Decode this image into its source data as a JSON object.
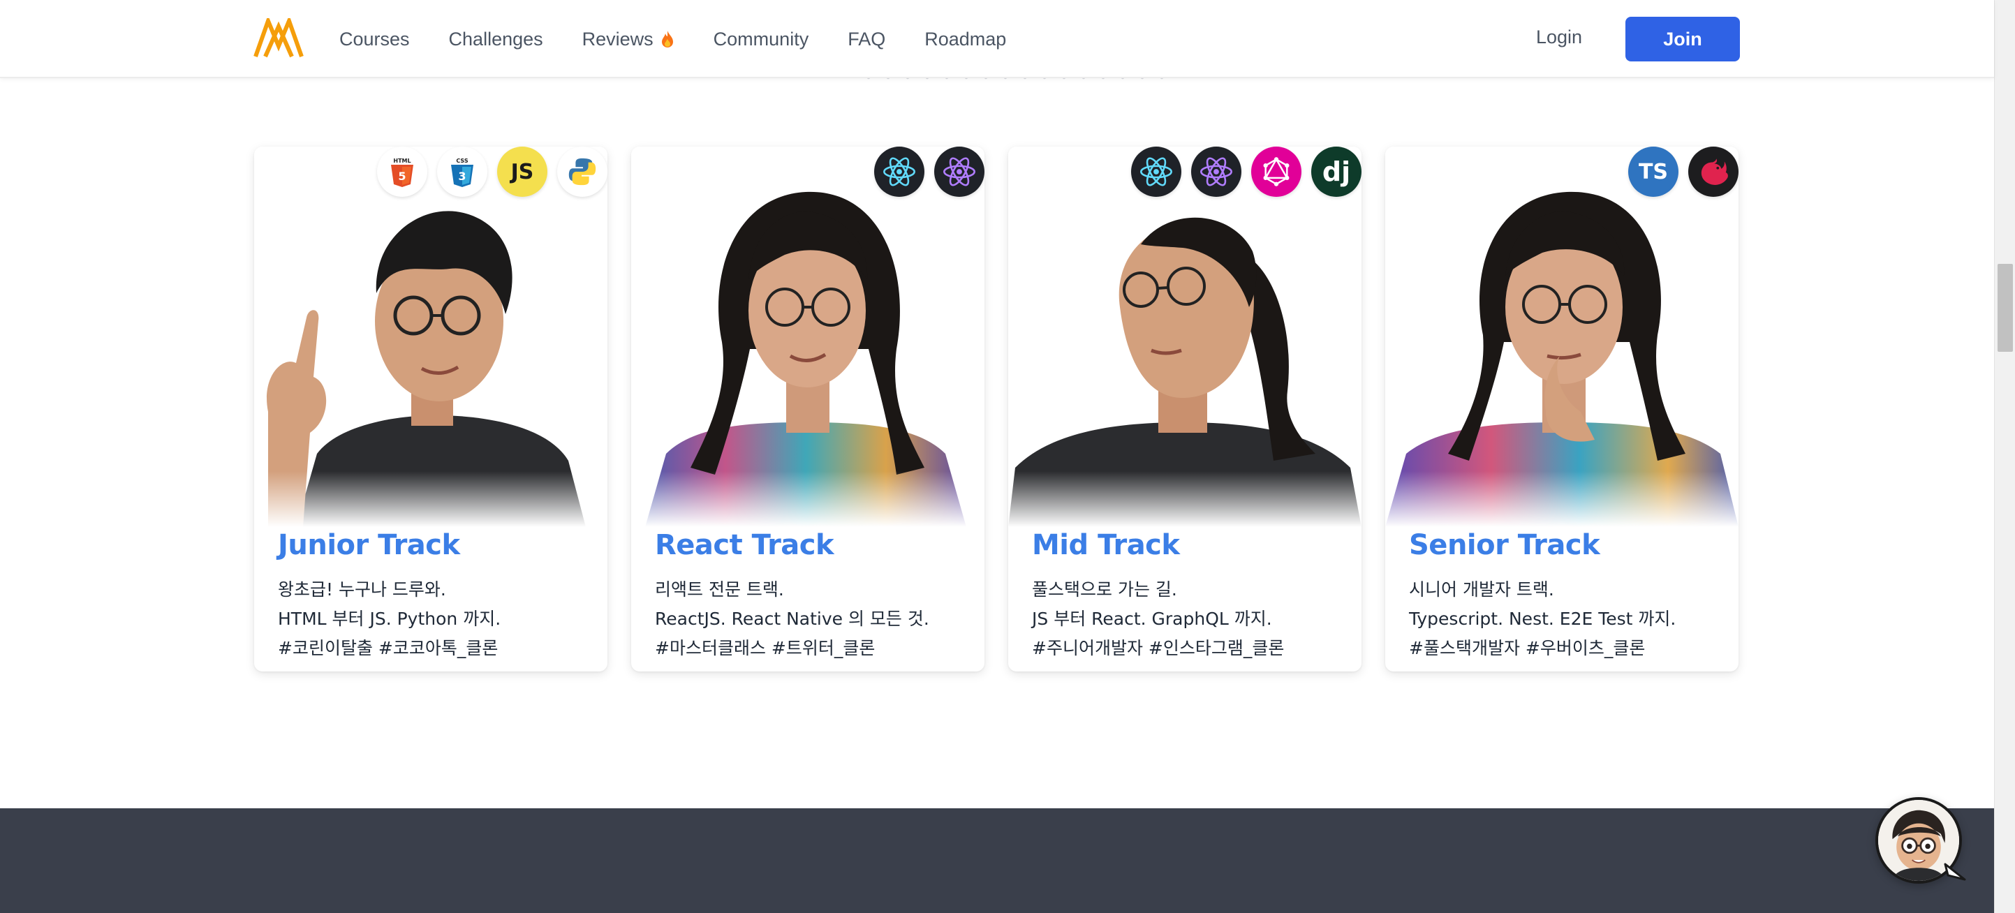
{
  "header": {
    "logo_name": "logo-icon",
    "nav": [
      {
        "label": "Courses"
      },
      {
        "label": "Challenges"
      },
      {
        "label": "Reviews",
        "badge_icon": "flame-icon"
      },
      {
        "label": "Community"
      },
      {
        "label": "FAQ"
      },
      {
        "label": "Roadmap"
      }
    ],
    "login_label": "Login",
    "join_label": "Join"
  },
  "cards": [
    {
      "title": "Junior Track",
      "lines": [
        "왕초급! 누구나 드루와.",
        "HTML 부터 JS. Python 까지.",
        "#코린이탈출 #코코아톡_클론"
      ],
      "tech_icons": [
        "html5-icon",
        "css3-icon",
        "javascript-icon",
        "python-icon"
      ],
      "js_text": "JS"
    },
    {
      "title": "React Track",
      "lines": [
        "리액트 전문 트랙.",
        "ReactJS. React Native 의 모든 것.",
        "#마스터클래스 #트위터_클론"
      ],
      "tech_icons": [
        "react-icon",
        "react-native-icon"
      ]
    },
    {
      "title": "Mid Track",
      "lines": [
        "풀스택으로 가는 길.",
        "JS 부터 React. GraphQL 까지.",
        "#주니어개발자 #인스타그램_클론"
      ],
      "tech_icons": [
        "react-icon",
        "react-native-icon",
        "graphql-icon",
        "django-icon"
      ],
      "dj_text": "dj"
    },
    {
      "title": "Senior Track",
      "lines": [
        "시니어 개발자 트랙.",
        "Typescript. Nest. E2E Test 까지.",
        "#풀스택개발자 #우버이츠_클론"
      ],
      "tech_icons": [
        "typescript-icon",
        "nestjs-icon"
      ],
      "ts_text": "TS"
    }
  ],
  "colors": {
    "accent": "#2f62e5",
    "track_title": "#3b7ee6",
    "footer": "#3a3f4b",
    "logo": "#f59e0b"
  },
  "chat": {
    "icon": "avatar-chat-icon"
  }
}
